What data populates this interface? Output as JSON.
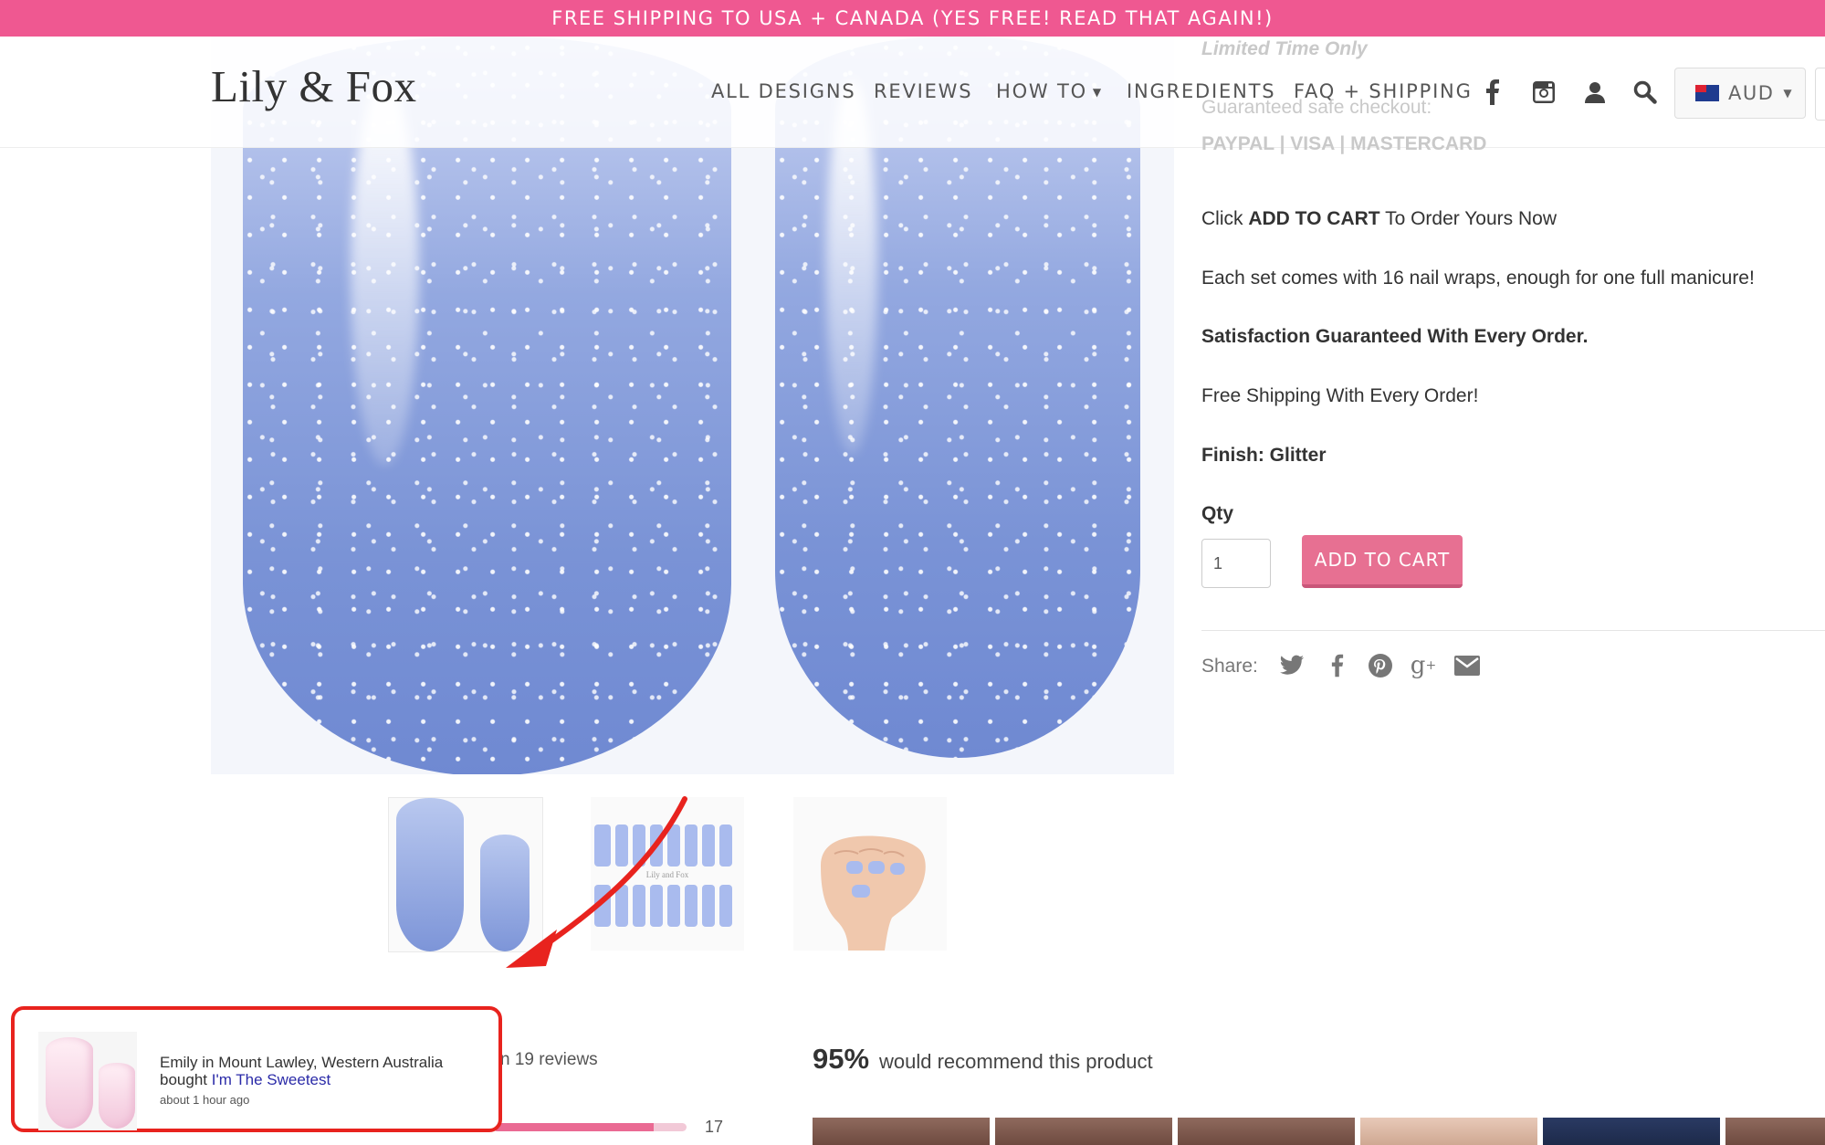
{
  "banner": {
    "text": "FREE SHIPPING TO USA + CANADA (YES FREE! READ THAT AGAIN!)"
  },
  "header": {
    "logo": "Lily & Fox",
    "nav": [
      {
        "label": "ALL DESIGNS"
      },
      {
        "label": "REVIEWS"
      },
      {
        "label": "HOW TO"
      },
      {
        "label": "INGREDIENTS"
      },
      {
        "label": "FAQ + SHIPPING"
      }
    ],
    "icons": [
      "facebook-icon",
      "instagram-icon",
      "account-icon",
      "search-icon"
    ],
    "currency": "AUD"
  },
  "product": {
    "limited": "Limited Time Only",
    "guaranteed": "Guaranteed safe checkout:",
    "payment": "PAYPAL | VISA | MASTERCARD",
    "click_prefix": "Click ",
    "click_bold": "ADD TO CART",
    "click_suffix": " To Order Yours Now",
    "set_info": "Each set comes with 16 nail wraps, enough for one full manicure!",
    "satisfaction": "Satisfaction Guaranteed With Every Order.",
    "free_shipping": "Free Shipping With Every Order!",
    "finish": "Finish: Glitter",
    "qty_label": "Qty",
    "qty_value": "1",
    "add_to_cart": "ADD TO CART",
    "share_label": "Share:",
    "share_icons": [
      "twitter-icon",
      "facebook-icon",
      "pinterest-icon",
      "google-plus-icon",
      "email-icon"
    ],
    "sheet_label": "Lily and Fox"
  },
  "reviews": {
    "count_text": "n 19 reviews",
    "recommend_pct": "95%",
    "recommend_text": "would recommend this product",
    "bar_count": "17",
    "bar_fraction": 0.83
  },
  "popup": {
    "line1": "Emily in Mount Lawley, Western Australia",
    "bought": "bought ",
    "product": "I'm The Sweetest",
    "time": "about 1 hour ago"
  },
  "colors": {
    "banner": "#ef5891",
    "button": "#e77092",
    "annotation": "#e8231e"
  }
}
